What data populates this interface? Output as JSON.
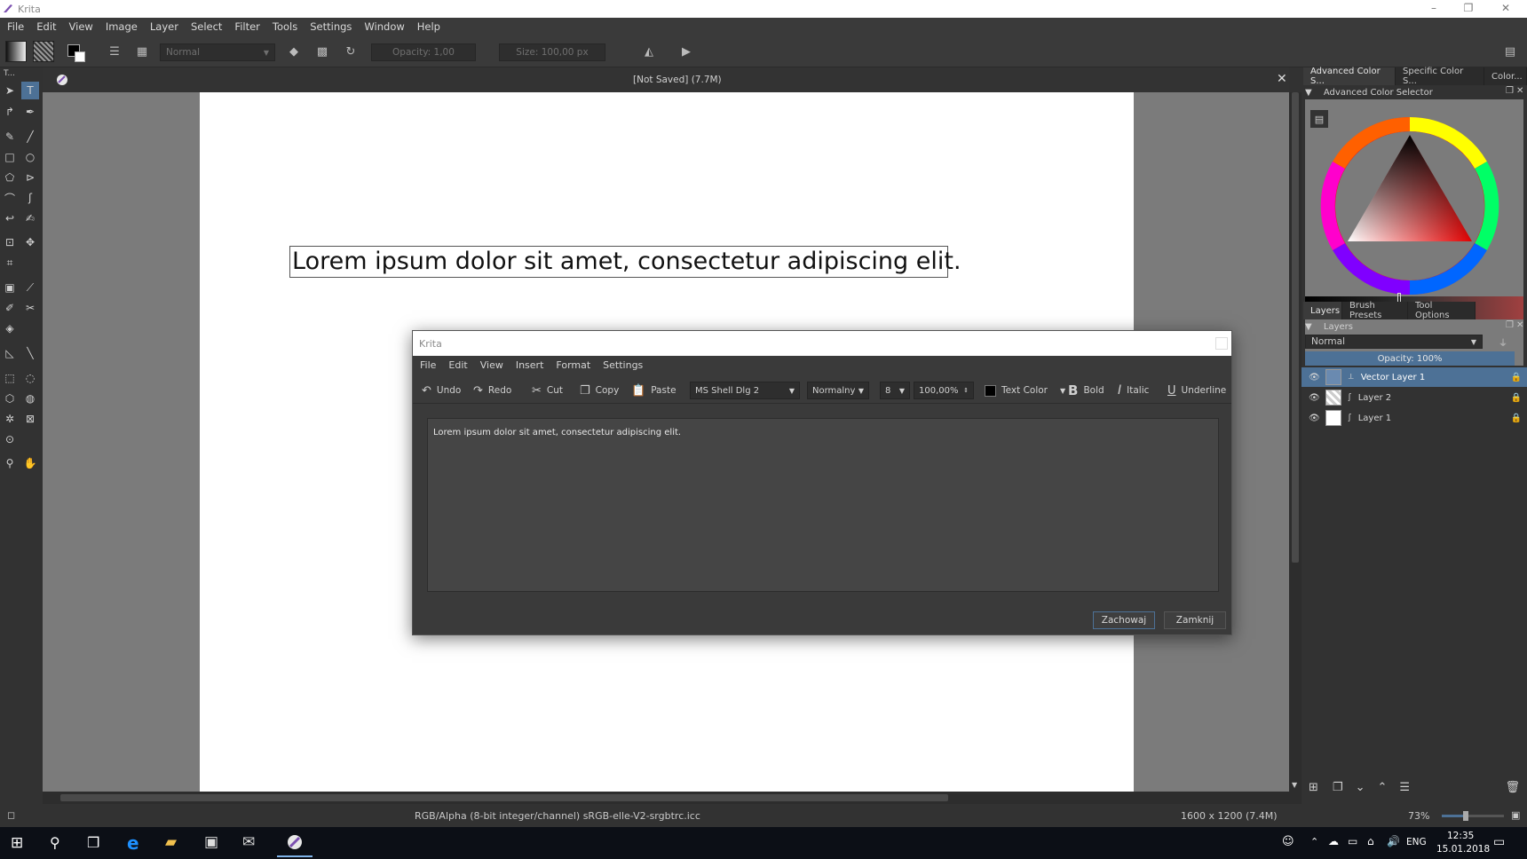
{
  "window": {
    "title": "Krita",
    "controls": [
      "–",
      "❐",
      "✕"
    ]
  },
  "menu": [
    "File",
    "Edit",
    "View",
    "Image",
    "Layer",
    "Select",
    "Filter",
    "Tools",
    "Settings",
    "Window",
    "Help"
  ],
  "toolbar": {
    "blend_mode": "Normal",
    "opacity": "Opacity:  1,00",
    "size": "Size:  100,00 px"
  },
  "toolbox": {
    "title": "T..."
  },
  "document": {
    "header": "[Not Saved]  (7.7M)",
    "text": "Lorem ipsum dolor sit amet, consectetur adipiscing elit."
  },
  "dockers": {
    "tabs_top": [
      "Advanced Color S...",
      "Specific Color S...",
      "Color..."
    ],
    "color_selector_title": "Advanced Color Selector",
    "tabs_bottom": [
      "Layers",
      "Brush Presets",
      "Tool Options"
    ],
    "layers_title": "Layers",
    "blend_mode": "Normal",
    "opacity": "Opacity:  100%",
    "layers": [
      {
        "name": "Vector Layer 1",
        "selected": true
      },
      {
        "name": "Layer 2",
        "selected": false
      },
      {
        "name": "Layer 1",
        "selected": false
      }
    ]
  },
  "dialog": {
    "title": "Krita",
    "menu": [
      "File",
      "Edit",
      "View",
      "Insert",
      "Format",
      "Settings"
    ],
    "toolbar": {
      "undo": "Undo",
      "redo": "Redo",
      "cut": "Cut",
      "copy": "Copy",
      "paste": "Paste",
      "font": "MS Shell Dlg 2",
      "style": "Normalny",
      "size": "8",
      "zoom": "100,00%",
      "text_color": "Text Color",
      "bold": "Bold",
      "italic": "Italic",
      "underline": "Underline"
    },
    "editor_text": "Lorem ipsum dolor sit amet, consectetur adipiscing elit.",
    "save_button": "Zachowaj",
    "close_button": "Zamknij"
  },
  "statusbar": {
    "colorspace": "RGB/Alpha (8-bit integer/channel)  sRGB-elle-V2-srgbtrc.icc",
    "dimensions": "1600 x 1200 (7.4M)",
    "zoom": "73%"
  },
  "taskbar": {
    "language": "ENG",
    "time": "12:35",
    "date": "15.01.2018"
  },
  "colors": {
    "accent_selected": "#4d7196",
    "ui_dark": "#323232",
    "canvas_bg": "#7b7b7b"
  }
}
